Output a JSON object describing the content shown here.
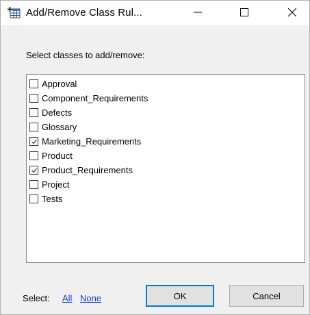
{
  "window": {
    "title": "Add/Remove Class Rul...",
    "app_icon": "table-add-icon",
    "controls": {
      "minimize_icon": "minimize-icon",
      "maximize_icon": "maximize-icon",
      "close_icon": "close-icon"
    }
  },
  "dialog": {
    "prompt": "Select classes to add/remove:",
    "items": [
      {
        "label": "Approval",
        "checked": false
      },
      {
        "label": "Component_Requirements",
        "checked": false
      },
      {
        "label": "Defects",
        "checked": false
      },
      {
        "label": "Glossary",
        "checked": false
      },
      {
        "label": "Marketing_Requirements",
        "checked": true
      },
      {
        "label": "Product",
        "checked": false
      },
      {
        "label": "Product_Requirements",
        "checked": true
      },
      {
        "label": "Project",
        "checked": false
      },
      {
        "label": "Tests",
        "checked": false
      }
    ]
  },
  "footer": {
    "select_label": "Select:",
    "all_link": "All",
    "none_link": "None",
    "ok_label": "OK",
    "cancel_label": "Cancel"
  },
  "colors": {
    "link": "#0b3fd6",
    "default_button_border": "#0078d7",
    "window_bg": "#f0f0f0"
  }
}
